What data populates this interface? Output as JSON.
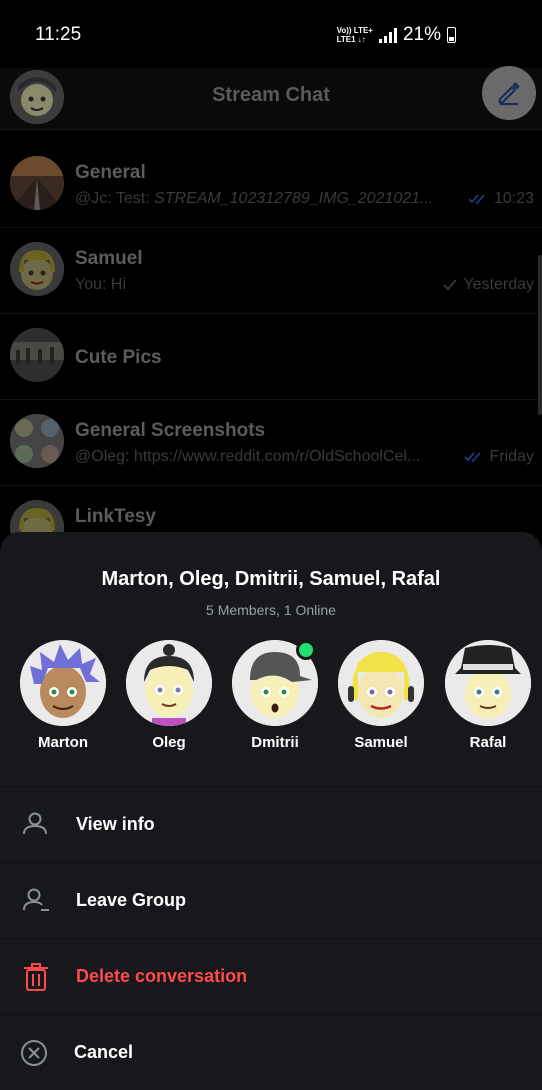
{
  "status_bar": {
    "time": "11:25",
    "network_top": "Vo)) LTE+",
    "network_bottom": "LTE1 ↓↑",
    "battery": "21%"
  },
  "header": {
    "title": "Stream Chat",
    "avatar_icon": "user-avatar",
    "compose_icon": "pencil-icon"
  },
  "channels": [
    {
      "name": "General",
      "preview_prefix": "@Jc: Test: ",
      "preview_italic": "STREAM_102312789_IMG_2021021...",
      "time": "10:23",
      "read_status": "double-check"
    },
    {
      "name": "Samuel",
      "preview_prefix": "You: Hi",
      "preview_italic": "",
      "time": "Yesterday",
      "read_status": "single-check"
    },
    {
      "name": "Cute Pics",
      "preview_prefix": "",
      "preview_italic": "",
      "time": "",
      "read_status": ""
    },
    {
      "name": "General Screenshots",
      "preview_prefix": "@Oleg: https://www.reddit.com/r/OldSchoolCel...",
      "preview_italic": "",
      "time": "Friday",
      "read_status": "double-check"
    },
    {
      "name": "LinkTesy",
      "preview_prefix": "",
      "preview_italic": "",
      "time": "",
      "read_status": ""
    }
  ],
  "sheet": {
    "title": "Marton, Oleg, Dmitrii, Samuel, Rafal",
    "subtitle": "5 Members,  1 Online",
    "members": [
      {
        "name": "Marton",
        "online": false,
        "hair_color": "#6f6fd6"
      },
      {
        "name": "Oleg",
        "online": false,
        "hair_color": "#2a2a2a"
      },
      {
        "name": "Dmitrii",
        "online": true,
        "hair_color": "#555555"
      },
      {
        "name": "Samuel",
        "online": false,
        "hair_color": "#f2e24a"
      },
      {
        "name": "Rafal",
        "online": false,
        "hair_color": "#222222"
      }
    ],
    "actions": [
      {
        "label": "View info",
        "icon": "person-icon",
        "danger": false
      },
      {
        "label": "Leave Group",
        "icon": "person-remove-icon",
        "danger": false
      },
      {
        "label": "Delete conversation",
        "icon": "trash-icon",
        "danger": true
      },
      {
        "label": "Cancel",
        "icon": "close-circle-icon",
        "danger": false
      }
    ]
  },
  "colors": {
    "accent": "#005fff",
    "danger": "#ff4a4a",
    "online": "#20e070",
    "sheet_bg": "#17181c"
  }
}
